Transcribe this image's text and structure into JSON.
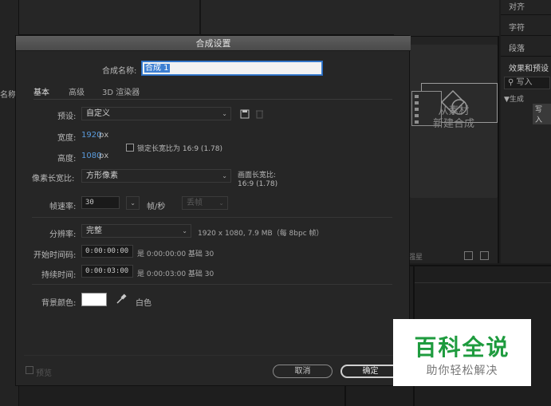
{
  "background": {
    "right_panel": {
      "items": [
        "对齐",
        "字符",
        "段落",
        "效果和预设"
      ],
      "search_text": "写入",
      "tree_item": "▼生成",
      "write_tag": "写入"
    },
    "center": {
      "new_from_footage_line1": "从素材",
      "new_from_footage_line2": "新建合成",
      "footer_text": "强星"
    },
    "left_fragments": [
      "名称"
    ]
  },
  "dialog": {
    "title": "合成设置",
    "comp_name_label": "合成名称:",
    "comp_name_value": "合成 1",
    "tabs": [
      "基本",
      "高级",
      "3D 渲染器"
    ],
    "preset_label": "预设:",
    "preset_value": "自定义",
    "width_label": "宽度:",
    "width_value": "1920",
    "width_unit": "px",
    "height_label": "高度:",
    "height_value": "1080",
    "height_unit": "px",
    "lock_ratio_label": "锁定长宽比为 16:9 (1.78)",
    "pixel_aspect_label": "像素长宽比:",
    "pixel_aspect_value": "方形像素",
    "frame_aspect_label": "画面长宽比:",
    "frame_aspect_value": "16:9 (1.78)",
    "frame_rate_label": "帧速率:",
    "frame_rate_value": "30",
    "frame_rate_unit": "帧/秒",
    "drop_frame_value": "丢帧",
    "resolution_label": "分辨率:",
    "resolution_value": "完整",
    "resolution_info": "1920 x 1080, 7.9 MB（每 8bpc 帧）",
    "start_timecode_label": "开始时间码:",
    "start_timecode_value": "0:00:00:00",
    "start_timecode_info": "是 0:00:00:00  基础 30",
    "duration_label": "持续时间:",
    "duration_value": "0:00:03:00",
    "duration_info": "是 0:00:03:00  基础 30",
    "bg_color_label": "背景颜色:",
    "bg_color_name": "白色",
    "bg_color_hex": "#FFFFFF",
    "preview_label": "预览",
    "cancel_label": "取消",
    "ok_label": "确定"
  },
  "watermark": {
    "title": "百科全说",
    "subtitle": "助你轻松解决"
  },
  "colors": {
    "accent_blue": "#5A9BDC",
    "watermark_green": "#1E9B3E"
  }
}
